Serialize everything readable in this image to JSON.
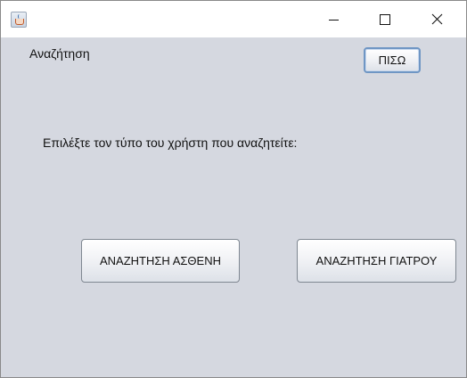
{
  "window": {
    "title": "",
    "icon": "java-cup-icon",
    "controls": {
      "minimize": "minimize-icon",
      "maximize": "maximize-icon",
      "close": "close-icon"
    }
  },
  "header": {
    "title": "Αναζήτηση",
    "back_label": "ΠΙΣΩ"
  },
  "main": {
    "instruction": "Επιλέξτε τον τύπο του χρήστη που αναζητείτε:",
    "search_patient_label": "ΑΝΑΖΗΤΗΣΗ ΑΣΘΕΝΗ",
    "search_doctor_label": "ΑΝΑΖΗΤΗΣΗ ΓΙΑΤΡΟΥ"
  },
  "colors": {
    "background": "#d5d8e0",
    "focus_border": "#6f96c4"
  }
}
